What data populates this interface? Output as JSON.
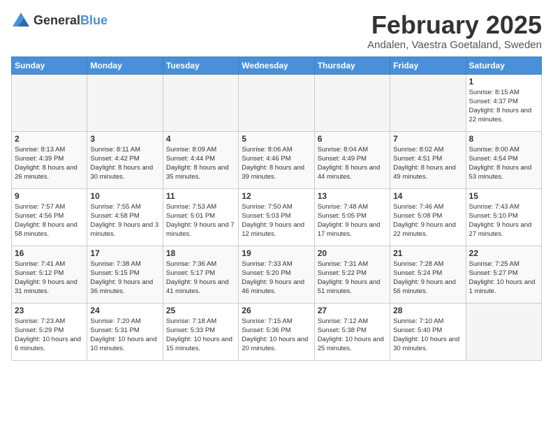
{
  "header": {
    "logo_general": "General",
    "logo_blue": "Blue",
    "month": "February 2025",
    "location": "Andalen, Vaestra Goetaland, Sweden"
  },
  "days_of_week": [
    "Sunday",
    "Monday",
    "Tuesday",
    "Wednesday",
    "Thursday",
    "Friday",
    "Saturday"
  ],
  "weeks": [
    {
      "days": [
        {
          "num": "",
          "info": ""
        },
        {
          "num": "",
          "info": ""
        },
        {
          "num": "",
          "info": ""
        },
        {
          "num": "",
          "info": ""
        },
        {
          "num": "",
          "info": ""
        },
        {
          "num": "",
          "info": ""
        },
        {
          "num": "1",
          "info": "Sunrise: 8:15 AM\nSunset: 4:37 PM\nDaylight: 8 hours and 22 minutes."
        }
      ]
    },
    {
      "days": [
        {
          "num": "2",
          "info": "Sunrise: 8:13 AM\nSunset: 4:39 PM\nDaylight: 8 hours and 26 minutes."
        },
        {
          "num": "3",
          "info": "Sunrise: 8:11 AM\nSunset: 4:42 PM\nDaylight: 8 hours and 30 minutes."
        },
        {
          "num": "4",
          "info": "Sunrise: 8:09 AM\nSunset: 4:44 PM\nDaylight: 8 hours and 35 minutes."
        },
        {
          "num": "5",
          "info": "Sunrise: 8:06 AM\nSunset: 4:46 PM\nDaylight: 8 hours and 39 minutes."
        },
        {
          "num": "6",
          "info": "Sunrise: 8:04 AM\nSunset: 4:49 PM\nDaylight: 8 hours and 44 minutes."
        },
        {
          "num": "7",
          "info": "Sunrise: 8:02 AM\nSunset: 4:51 PM\nDaylight: 8 hours and 49 minutes."
        },
        {
          "num": "8",
          "info": "Sunrise: 8:00 AM\nSunset: 4:54 PM\nDaylight: 8 hours and 53 minutes."
        }
      ]
    },
    {
      "days": [
        {
          "num": "9",
          "info": "Sunrise: 7:57 AM\nSunset: 4:56 PM\nDaylight: 8 hours and 58 minutes."
        },
        {
          "num": "10",
          "info": "Sunrise: 7:55 AM\nSunset: 4:58 PM\nDaylight: 9 hours and 3 minutes."
        },
        {
          "num": "11",
          "info": "Sunrise: 7:53 AM\nSunset: 5:01 PM\nDaylight: 9 hours and 7 minutes."
        },
        {
          "num": "12",
          "info": "Sunrise: 7:50 AM\nSunset: 5:03 PM\nDaylight: 9 hours and 12 minutes."
        },
        {
          "num": "13",
          "info": "Sunrise: 7:48 AM\nSunset: 5:05 PM\nDaylight: 9 hours and 17 minutes."
        },
        {
          "num": "14",
          "info": "Sunrise: 7:46 AM\nSunset: 5:08 PM\nDaylight: 9 hours and 22 minutes."
        },
        {
          "num": "15",
          "info": "Sunrise: 7:43 AM\nSunset: 5:10 PM\nDaylight: 9 hours and 27 minutes."
        }
      ]
    },
    {
      "days": [
        {
          "num": "16",
          "info": "Sunrise: 7:41 AM\nSunset: 5:12 PM\nDaylight: 9 hours and 31 minutes."
        },
        {
          "num": "17",
          "info": "Sunrise: 7:38 AM\nSunset: 5:15 PM\nDaylight: 9 hours and 36 minutes."
        },
        {
          "num": "18",
          "info": "Sunrise: 7:36 AM\nSunset: 5:17 PM\nDaylight: 9 hours and 41 minutes."
        },
        {
          "num": "19",
          "info": "Sunrise: 7:33 AM\nSunset: 5:20 PM\nDaylight: 9 hours and 46 minutes."
        },
        {
          "num": "20",
          "info": "Sunrise: 7:31 AM\nSunset: 5:22 PM\nDaylight: 9 hours and 51 minutes."
        },
        {
          "num": "21",
          "info": "Sunrise: 7:28 AM\nSunset: 5:24 PM\nDaylight: 9 hours and 56 minutes."
        },
        {
          "num": "22",
          "info": "Sunrise: 7:25 AM\nSunset: 5:27 PM\nDaylight: 10 hours and 1 minute."
        }
      ]
    },
    {
      "days": [
        {
          "num": "23",
          "info": "Sunrise: 7:23 AM\nSunset: 5:29 PM\nDaylight: 10 hours and 6 minutes."
        },
        {
          "num": "24",
          "info": "Sunrise: 7:20 AM\nSunset: 5:31 PM\nDaylight: 10 hours and 10 minutes."
        },
        {
          "num": "25",
          "info": "Sunrise: 7:18 AM\nSunset: 5:33 PM\nDaylight: 10 hours and 15 minutes."
        },
        {
          "num": "26",
          "info": "Sunrise: 7:15 AM\nSunset: 5:36 PM\nDaylight: 10 hours and 20 minutes."
        },
        {
          "num": "27",
          "info": "Sunrise: 7:12 AM\nSunset: 5:38 PM\nDaylight: 10 hours and 25 minutes."
        },
        {
          "num": "28",
          "info": "Sunrise: 7:10 AM\nSunset: 5:40 PM\nDaylight: 10 hours and 30 minutes."
        },
        {
          "num": "",
          "info": ""
        }
      ]
    }
  ]
}
